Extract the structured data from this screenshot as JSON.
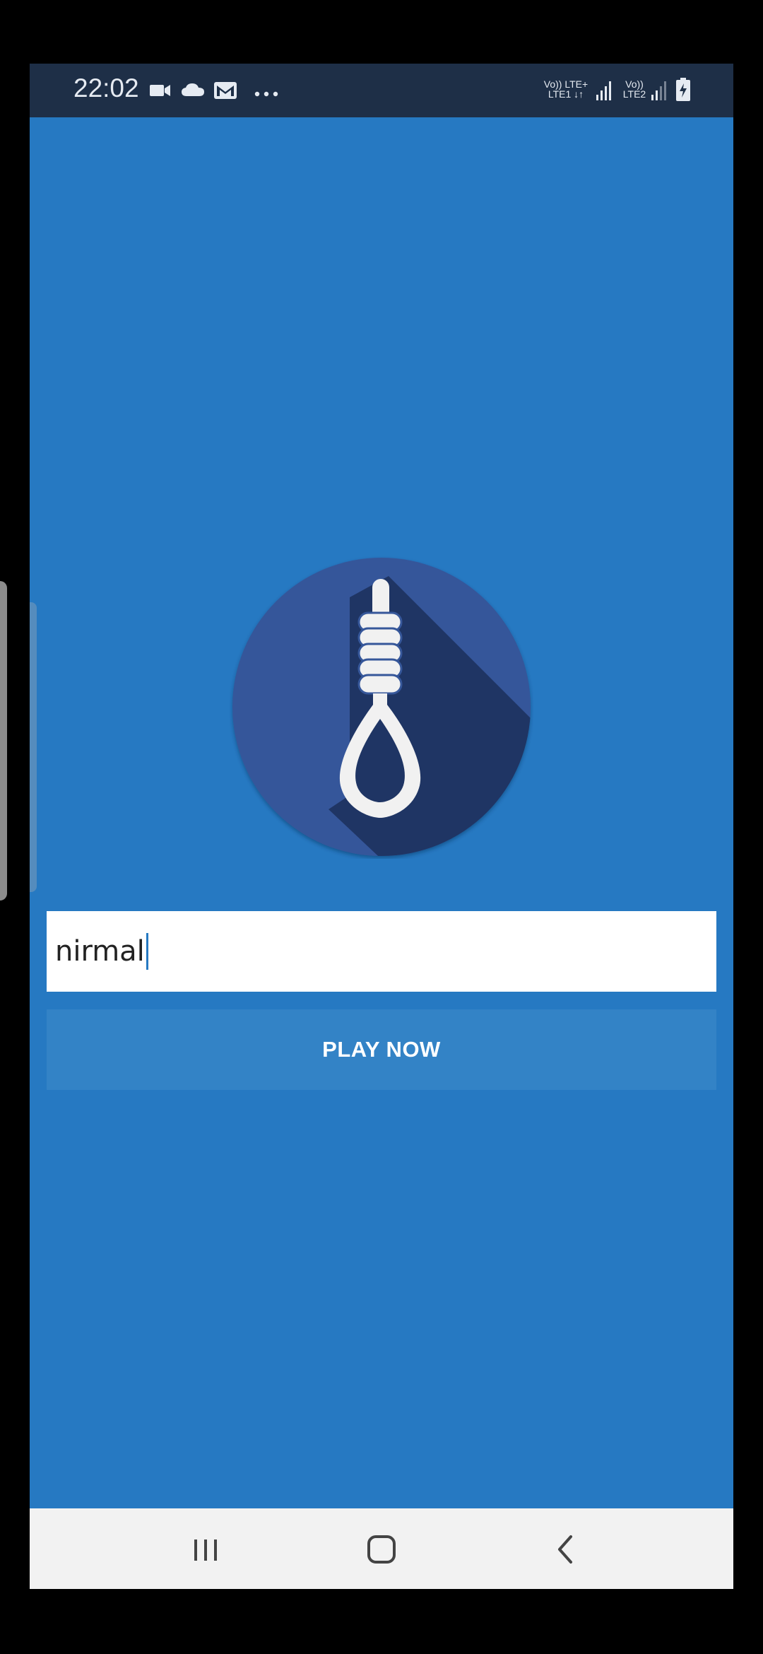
{
  "status_bar": {
    "time": "22:02",
    "notification_icons": [
      "video-camera-icon",
      "cloud-icon",
      "gmail-icon",
      "more-dots-icon"
    ],
    "sim1_top": "Vo)) LTE+",
    "sim1_bottom": "LTE1",
    "sim2_top": "Vo))",
    "sim2_bottom": "LTE2"
  },
  "main": {
    "input": {
      "value": "nirmal"
    },
    "play_button_label": "PLAY NOW"
  },
  "nav_bar": {
    "buttons": [
      "recent-apps",
      "home",
      "back"
    ]
  },
  "colors": {
    "background": "#2679c2",
    "status_bar": "#1e2f47",
    "logo_circle": "#36579a",
    "logo_shadow": "#1f3564",
    "play_button": "#3383c6",
    "nav_bar": "#f2f2f2"
  }
}
